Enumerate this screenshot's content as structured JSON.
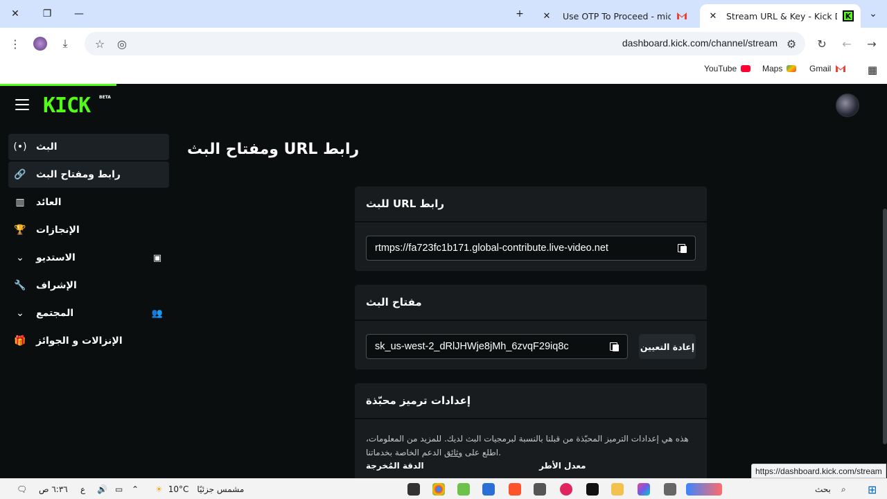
{
  "browser": {
    "tabs": [
      {
        "title": "Use OTP To Proceed - midoggn",
        "favicon": "gmail-icon",
        "active": false
      },
      {
        "title": "Stream URL & Key - Kick Dashb",
        "favicon": "kick-icon",
        "active": true
      }
    ],
    "url": "dashboard.kick.com/channel/stream",
    "bookmarks": [
      {
        "label": "YouTube",
        "icon": "youtube-icon",
        "color": "#ff0033"
      },
      {
        "label": "Maps",
        "icon": "maps-icon",
        "color": "#34a853"
      },
      {
        "label": "Gmail",
        "icon": "gmail-icon",
        "color": "#ea4335"
      }
    ],
    "status_url": "https://dashboard.kick.com/stream"
  },
  "header": {
    "logo": "KICK",
    "logo_badge": "BETA",
    "accent": "#53fc18"
  },
  "sidebar": {
    "items": [
      {
        "label": "البث",
        "icon": "broadcast-icon"
      },
      {
        "label": "رابط ومفتاح البث",
        "icon": "link-icon"
      },
      {
        "label": "العائد",
        "icon": "chart-icon"
      },
      {
        "label": "الإنجازات",
        "icon": "trophy-icon"
      },
      {
        "label": "الاستديو",
        "icon": "chevron-down-icon",
        "extra": "studio-icon"
      },
      {
        "label": "الإشراف",
        "icon": "wrench-icon"
      },
      {
        "label": "المجتمع",
        "icon": "chevron-down-icon",
        "extra": "users-icon"
      },
      {
        "label": "الإنزالات و الجوائز",
        "icon": "gift-icon"
      }
    ]
  },
  "main": {
    "title": "ومفتاح البث URL رابط",
    "url_card": {
      "heading": "للبث URL رابط",
      "value": "rtmps://fa723fc1b171.global-contribute.live-video.net"
    },
    "key_card": {
      "heading": "مفتاح البث",
      "value": "sk_us-west-2_dRlJHWje8jMh_6zvqF29iq8c",
      "reset_label": "إعادة التعيين"
    },
    "encoder_card": {
      "heading": "إعدادات ترميز محبّذة",
      "text_before_link": "هذه هي إعدادات الترميز المحبّذة من قبلنا بالنسبة لبرمجيات البث لديك. للمزيد من المعلومات، اطلع على ",
      "link_text": "وثائق",
      "text_after_link": " الدعم الخاصة بخدماتنا.",
      "col_resolution": "الدقة المُخرجة",
      "col_framerate": "معدل الأطر"
    }
  },
  "taskbar": {
    "time": "٦:٣٦ ص",
    "lang": "ع",
    "weather_temp": "10°C",
    "weather_text": "مشمس جزئيًا",
    "search_label": "بحث"
  }
}
